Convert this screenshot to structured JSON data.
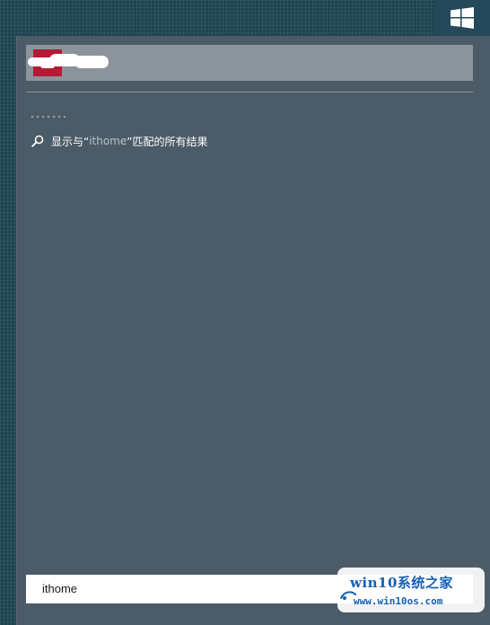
{
  "start_button": {
    "icon": "windows-logo-icon"
  },
  "best_match": {
    "tile_color": "#b31b34",
    "icon": "app-tile-icon"
  },
  "web_search": {
    "icon": "search-icon",
    "prefix": "显示与“",
    "query": "ithome",
    "suffix": "”匹配的所有结果"
  },
  "search_box": {
    "value": "ithome"
  },
  "watermark": {
    "title": "win10系统之家",
    "url": "www.win10os.com"
  },
  "colors": {
    "desktop": "#1f4452",
    "panel": "#4c5b68",
    "best_match_bg": "#8b949c",
    "watermark_text": "#1460b4"
  }
}
